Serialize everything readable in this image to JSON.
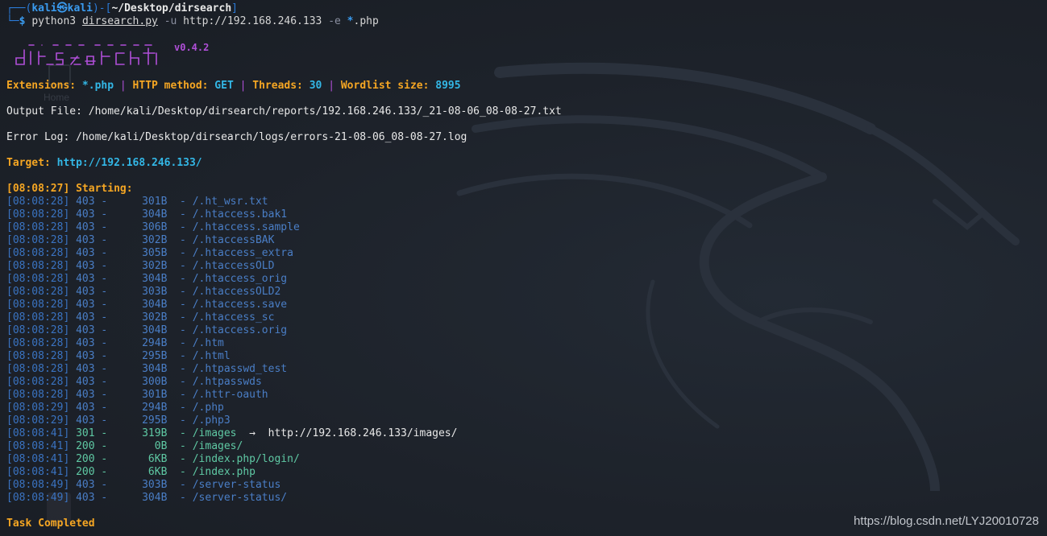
{
  "prompt": {
    "corner_top": "┌──(",
    "user": "kali",
    "at_symbol": "㉿",
    "host": "kali",
    "path_open": ")-[",
    "path": "~/Desktop/dirsearch",
    "path_close": "]",
    "corner_bottom": "└─",
    "dollar": "$",
    "cmd": "python3",
    "script": "dirsearch.py",
    "flag_u": "-u",
    "url": "http://192.168.246.133",
    "flag_e": "-e",
    "ext_star": "*",
    "ext": ".php"
  },
  "banner": {
    "version": "v0.4.2"
  },
  "config": {
    "ext_label": "Extensions:",
    "ext_value": "*.php",
    "sep": "|",
    "method_label": "HTTP method:",
    "method_value": "GET",
    "threads_label": "Threads:",
    "threads_value": "30",
    "wordlist_label": "Wordlist size:",
    "wordlist_value": "8995"
  },
  "output_file": "Output File: /home/kali/Desktop/dirsearch/reports/192.168.246.133/_21-08-06_08-08-27.txt",
  "error_log": "Error Log: /home/kali/Desktop/dirsearch/logs/errors-21-08-06_08-08-27.log",
  "target": {
    "label": "Target:",
    "value": "http://192.168.246.133/"
  },
  "starting": {
    "time": "[08:08:27]",
    "label": "Starting:"
  },
  "results": [
    {
      "time": "[08:08:28]",
      "status": "403",
      "size": "301B",
      "path": "/.ht_wsr.txt",
      "redirect": ""
    },
    {
      "time": "[08:08:28]",
      "status": "403",
      "size": "304B",
      "path": "/.htaccess.bak1",
      "redirect": ""
    },
    {
      "time": "[08:08:28]",
      "status": "403",
      "size": "306B",
      "path": "/.htaccess.sample",
      "redirect": ""
    },
    {
      "time": "[08:08:28]",
      "status": "403",
      "size": "302B",
      "path": "/.htaccessBAK",
      "redirect": ""
    },
    {
      "time": "[08:08:28]",
      "status": "403",
      "size": "305B",
      "path": "/.htaccess_extra",
      "redirect": ""
    },
    {
      "time": "[08:08:28]",
      "status": "403",
      "size": "302B",
      "path": "/.htaccessOLD",
      "redirect": ""
    },
    {
      "time": "[08:08:28]",
      "status": "403",
      "size": "304B",
      "path": "/.htaccess_orig",
      "redirect": ""
    },
    {
      "time": "[08:08:28]",
      "status": "403",
      "size": "303B",
      "path": "/.htaccessOLD2",
      "redirect": ""
    },
    {
      "time": "[08:08:28]",
      "status": "403",
      "size": "304B",
      "path": "/.htaccess.save",
      "redirect": ""
    },
    {
      "time": "[08:08:28]",
      "status": "403",
      "size": "302B",
      "path": "/.htaccess_sc",
      "redirect": ""
    },
    {
      "time": "[08:08:28]",
      "status": "403",
      "size": "304B",
      "path": "/.htaccess.orig",
      "redirect": ""
    },
    {
      "time": "[08:08:28]",
      "status": "403",
      "size": "294B",
      "path": "/.htm",
      "redirect": ""
    },
    {
      "time": "[08:08:28]",
      "status": "403",
      "size": "295B",
      "path": "/.html",
      "redirect": ""
    },
    {
      "time": "[08:08:28]",
      "status": "403",
      "size": "304B",
      "path": "/.htpasswd_test",
      "redirect": ""
    },
    {
      "time": "[08:08:28]",
      "status": "403",
      "size": "300B",
      "path": "/.htpasswds",
      "redirect": ""
    },
    {
      "time": "[08:08:28]",
      "status": "403",
      "size": "301B",
      "path": "/.httr-oauth",
      "redirect": ""
    },
    {
      "time": "[08:08:29]",
      "status": "403",
      "size": "294B",
      "path": "/.php",
      "redirect": ""
    },
    {
      "time": "[08:08:29]",
      "status": "403",
      "size": "295B",
      "path": "/.php3",
      "redirect": ""
    },
    {
      "time": "[08:08:41]",
      "status": "301",
      "size": "319B",
      "path": "/images",
      "redirect": "http://192.168.246.133/images/"
    },
    {
      "time": "[08:08:41]",
      "status": "200",
      "size": "0B",
      "path": "/images/",
      "redirect": ""
    },
    {
      "time": "[08:08:41]",
      "status": "200",
      "size": "6KB",
      "path": "/index.php/login/",
      "redirect": ""
    },
    {
      "time": "[08:08:41]",
      "status": "200",
      "size": "6KB",
      "path": "/index.php",
      "redirect": ""
    },
    {
      "time": "[08:08:49]",
      "status": "403",
      "size": "303B",
      "path": "/server-status",
      "redirect": ""
    },
    {
      "time": "[08:08:49]",
      "status": "403",
      "size": "304B",
      "path": "/server-status/",
      "redirect": ""
    }
  ],
  "redirect_arrow": "→",
  "task_completed": "Task Completed",
  "watermark": "https://blog.csdn.net/LYJ20010728",
  "ghost_label": "Home",
  "colors": {
    "background": "#1c2129",
    "accent_orange": "#f5a623",
    "accent_cyan": "#33b7e6",
    "accent_purple": "#b04fd8",
    "status_403": "#4a7ec6",
    "status_ok": "#5fc9a4"
  }
}
